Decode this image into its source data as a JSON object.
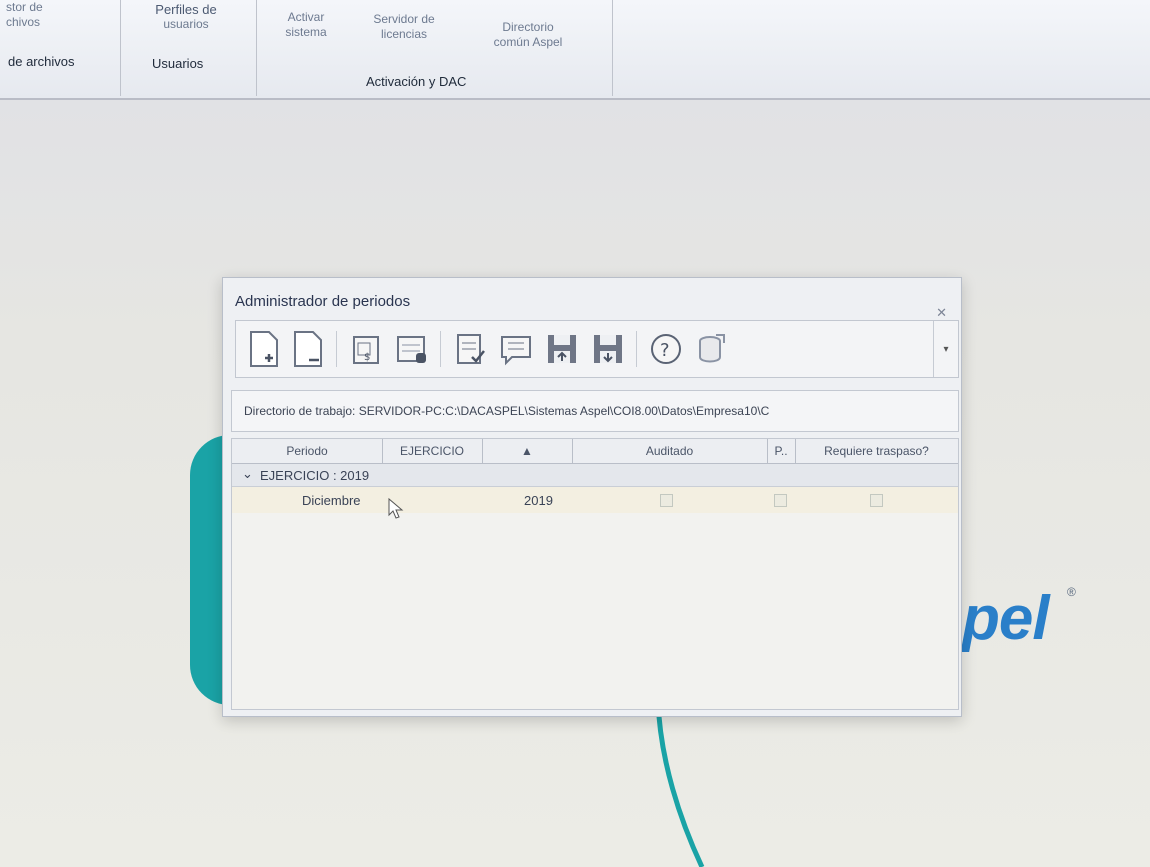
{
  "ribbon": {
    "group1": {
      "items": [
        "stor de",
        "chivos"
      ],
      "label": "de archivos"
    },
    "group2": {
      "item": [
        "Perfiles de",
        "usuarios"
      ],
      "label": "Usuarios"
    },
    "group3": {
      "items": [
        {
          "line1": "Activar",
          "line2": "sistema"
        },
        {
          "line1": "Servidor de",
          "line2": "licencias"
        },
        {
          "line1": "Directorio",
          "line2": "común Aspel"
        }
      ],
      "label": "Activación y DAC"
    }
  },
  "background": {
    "brand": "pel",
    "registered": "®"
  },
  "dialog": {
    "title": "Administrador de periodos",
    "close": "✕",
    "directory": "Directorio de trabajo: SERVIDOR-PC:C:\\DACASPEL\\Sistemas Aspel\\COI8.00\\Datos\\Empresa10\\C",
    "columns": [
      "Periodo",
      "EJERCICIO",
      "▲",
      "Auditado",
      "P..",
      "Requiere traspaso?"
    ],
    "group": {
      "expander": "⌄",
      "label": "EJERCICIO : 2019"
    },
    "rows": [
      {
        "periodo": "Diciembre",
        "ejercicio": "2019"
      }
    ]
  },
  "colors": {
    "teal": "#1aa3a6",
    "brand_blue": "#2a7fc9"
  }
}
